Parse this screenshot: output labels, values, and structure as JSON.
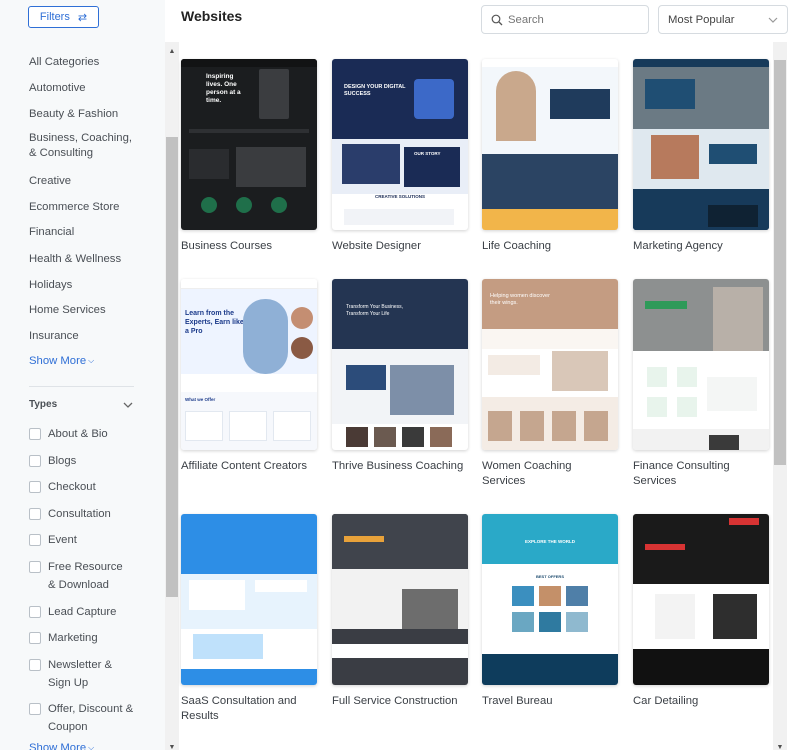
{
  "sidebar": {
    "filters_label": "Filters",
    "categories": [
      "All Categories",
      "Automotive",
      "Beauty & Fashion",
      "Business, Coaching,\n& Consulting",
      "Creative",
      "Ecommerce Store",
      "Financial",
      "Health & Wellness",
      "Holidays",
      "Home Services",
      "Insurance"
    ],
    "show_more_label": "Show More",
    "types_heading": "Types",
    "types": [
      "About & Bio",
      "Blogs",
      "Checkout",
      "Consultation",
      "Event",
      "Free Resource & Download",
      "Lead Capture",
      "Marketing",
      "Newsletter & Sign Up",
      "Offer, Discount & Coupon"
    ],
    "show_more_bottom": "Show More"
  },
  "header": {
    "title": "Websites",
    "search_placeholder": "Search",
    "sort_value": "Most Popular"
  },
  "templates": [
    {
      "name": "Business Courses",
      "theme": "dark"
    },
    {
      "name": "Website Designer",
      "theme": "navy"
    },
    {
      "name": "Life Coaching",
      "theme": "light-blue"
    },
    {
      "name": "Marketing Agency",
      "theme": "teal"
    },
    {
      "name": "Affiliate Content Creators",
      "theme": "white-blue"
    },
    {
      "name": "Thrive Business Coaching",
      "theme": "navy-white"
    },
    {
      "name": "Women Coaching Services",
      "theme": "tan"
    },
    {
      "name": "Finance Consulting Services",
      "theme": "grey-green"
    },
    {
      "name": "SaaS Consultation and Results",
      "theme": "sky"
    },
    {
      "name": "Full Service Construction",
      "theme": "charcoal"
    },
    {
      "name": "Travel Bureau",
      "theme": "ocean"
    },
    {
      "name": "Car Detailing",
      "theme": "black-red"
    }
  ],
  "thumb_text": {
    "t0_headline": "Inspiring lives. One person at a time.",
    "t1_headline": "DESIGN YOUR DIGITAL SUCCESS",
    "t1_story": "OUR STORY",
    "t1_creative": "CREATIVE SOLUTIONS",
    "t4_headline": "Learn from the Experts, Earn like a Pro",
    "t4_offer": "What we Offer",
    "t5_headline": "Transform Your Business, Transform Your Life",
    "t6_headline": "Helping women discover their wings.",
    "t10_headline": "EXPLORE THE WORLD",
    "t10_offers": "BEST OFFERS"
  },
  "colors": {
    "accent": "#2f6fd6",
    "sidebar_bg": "#f7f9fa"
  }
}
